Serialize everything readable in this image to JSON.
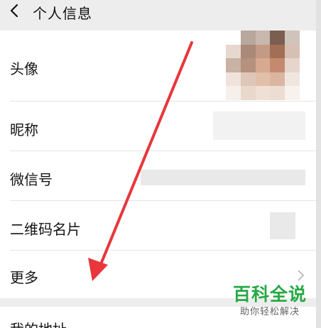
{
  "header": {
    "title": "个人信息",
    "back_icon": "back-chevron-icon"
  },
  "rows": [
    {
      "label": "头像"
    },
    {
      "label": "昵称"
    },
    {
      "label": "微信号"
    },
    {
      "label": "二维码名片"
    },
    {
      "label": "更多"
    }
  ],
  "bottom_row": {
    "label": "我的地址"
  },
  "watermark": {
    "title": "百科全说",
    "subtitle": "助你轻松解决"
  },
  "colors": {
    "accent_arrow": "#e8363c",
    "watermark_green": "#27a844",
    "avatar_pixels": [
      "#ffffff",
      "#b7a79d",
      "#c8b7ac",
      "#7a5f50",
      "#d0c3ba",
      "#e7d8cf",
      "#a98a79",
      "#c39a85",
      "#a26e56",
      "#d7c0b3",
      "#c9b1a3",
      "#b6917e",
      "#d7a991",
      "#c48a6f",
      "#e6d5cb",
      "#efe3dc",
      "#dec6b8",
      "#e2bfa8",
      "#dbb59f",
      "#f1e6df",
      "#f7efea",
      "#ead8cd",
      "#efdfd5",
      "#ecdcd2",
      "#f8f1ed"
    ]
  }
}
